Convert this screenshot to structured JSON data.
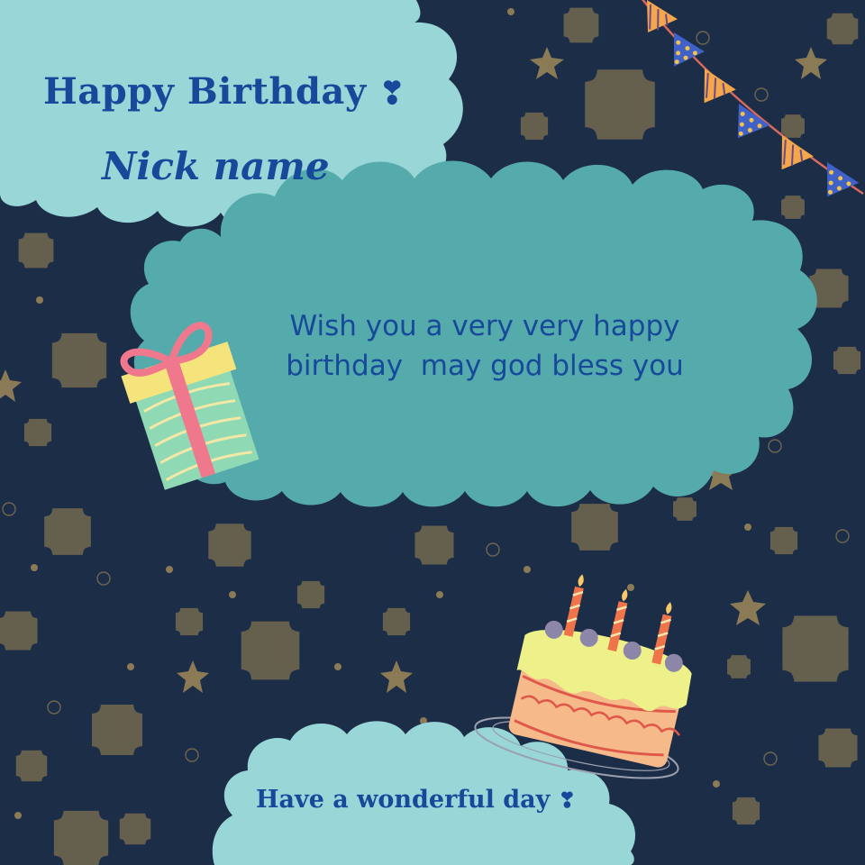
{
  "card": {
    "heading": "Happy Birthday",
    "heading_heart": "❣",
    "nickname": "Nick name",
    "message_line1": "Wish you a very very happy",
    "message_line2": "birthday  may god bless you",
    "footer": "Have a wonderful day",
    "footer_heart": "❣"
  },
  "colors": {
    "background": "#1c2d47",
    "cloud_light": "#98d6d8",
    "cloud_mid": "#55abac",
    "text": "#16499a",
    "star": "#8a7a56"
  },
  "decorations": {
    "icons": [
      "star-pattern",
      "bunting-banner",
      "gift-box-icon",
      "birthday-cake-icon",
      "cloud-shape"
    ]
  }
}
